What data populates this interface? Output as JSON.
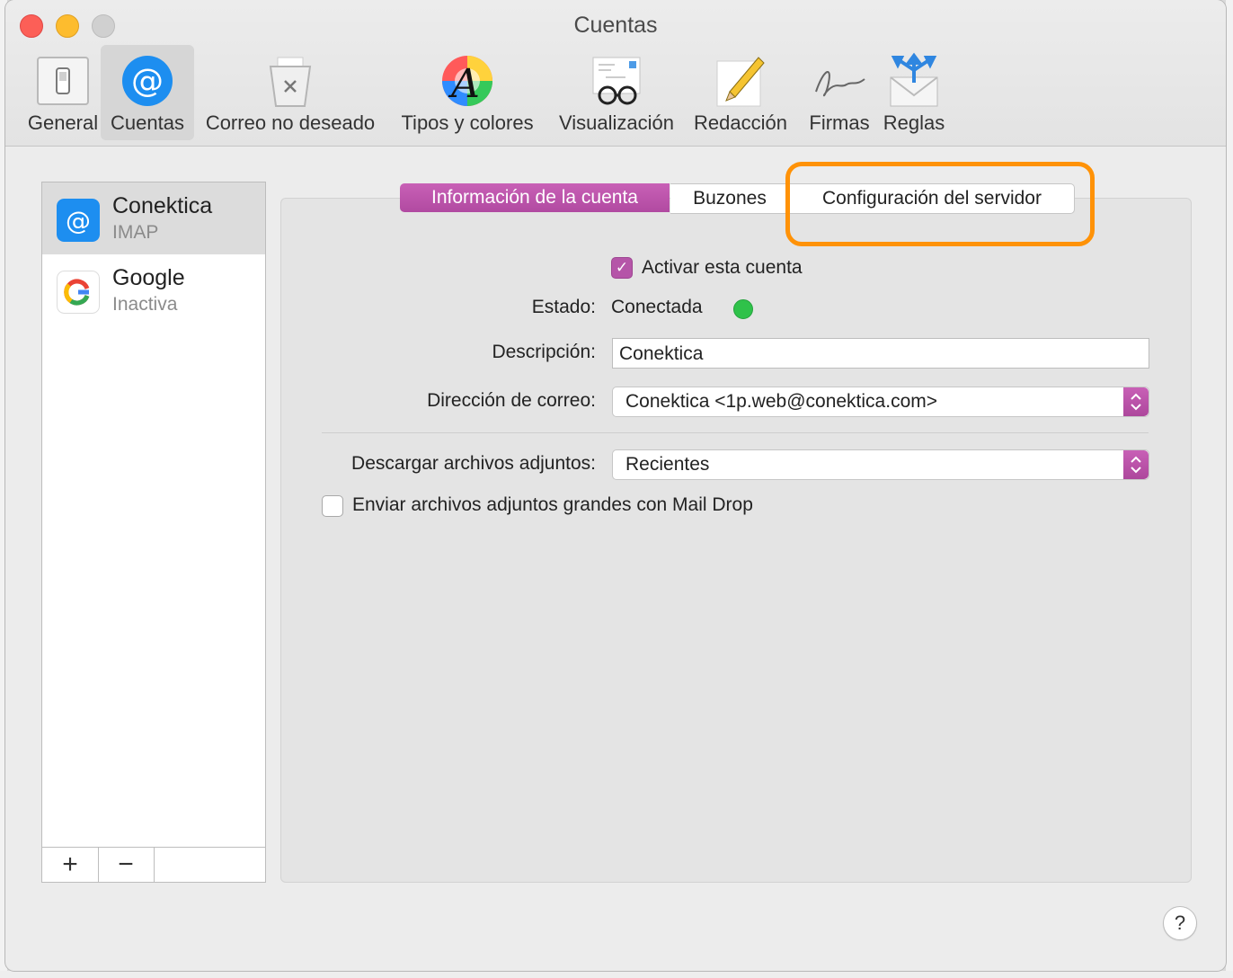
{
  "window": {
    "title": "Cuentas"
  },
  "toolbar": {
    "items": [
      {
        "label": "General",
        "icon": "switch-icon"
      },
      {
        "label": "Cuentas",
        "icon": "at-sign-icon",
        "selected": true
      },
      {
        "label": "Correo no deseado",
        "icon": "trash-can-icon"
      },
      {
        "label": "Tipos y colores",
        "icon": "font-color-wheel-icon"
      },
      {
        "label": "Visualización",
        "icon": "glasses-letter-icon"
      },
      {
        "label": "Redacción",
        "icon": "pencil-paper-icon"
      },
      {
        "label": "Firmas",
        "icon": "signature-icon"
      },
      {
        "label": "Reglas",
        "icon": "envelope-arrows-icon"
      }
    ]
  },
  "accounts": [
    {
      "name": "Conektica",
      "type": "IMAP",
      "icon": "at-sign-icon",
      "selected": true
    },
    {
      "name": "Google",
      "type": "Inactiva",
      "icon": "google-icon"
    }
  ],
  "account_buttons": {
    "add": "+",
    "remove": "−"
  },
  "tabs": [
    {
      "label": "Información de la cuenta",
      "active": true
    },
    {
      "label": "Buzones"
    },
    {
      "label": "Configuración del servidor",
      "highlighted": true
    }
  ],
  "form": {
    "enable_account": {
      "label": "Activar esta cuenta",
      "checked": true
    },
    "status": {
      "label": "Estado:",
      "value": "Conectada",
      "color": "#2fc24a"
    },
    "description": {
      "label": "Descripción:",
      "value": "Conektica"
    },
    "email": {
      "label": "Dirección de correo:",
      "value": "Conektica <1p.web@conektica.com>"
    },
    "download_attachments": {
      "label": "Descargar archivos adjuntos:",
      "value": "Recientes"
    },
    "mail_drop": {
      "label": "Enviar archivos adjuntos grandes con Mail Drop",
      "checked": false
    }
  },
  "help": {
    "label": "?"
  },
  "colors": {
    "accent": "#b555a8",
    "highlight": "#ff9207"
  }
}
